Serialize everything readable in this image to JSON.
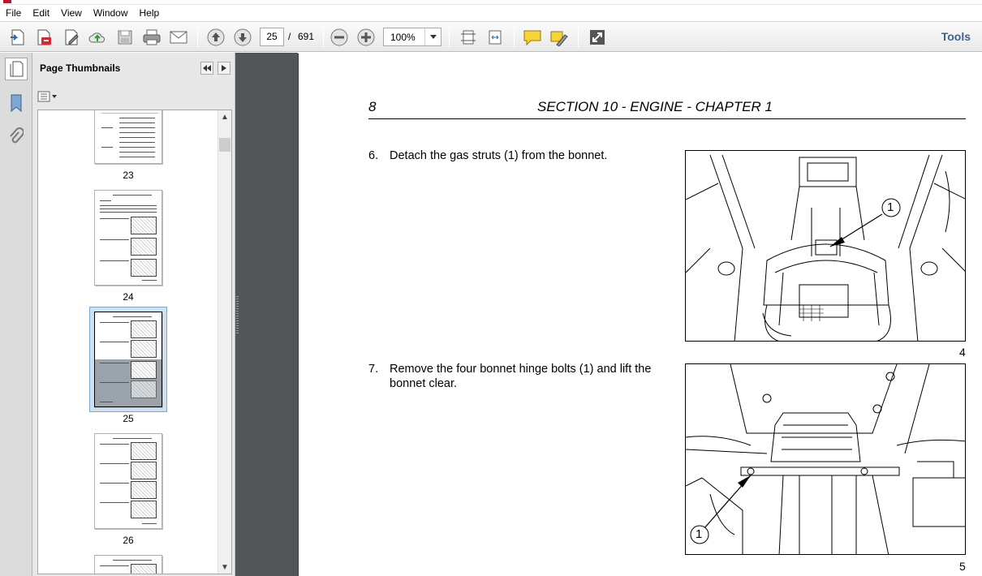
{
  "menu": [
    "File",
    "Edit",
    "View",
    "Window",
    "Help"
  ],
  "toolbar": {
    "current_page": "25",
    "page_separator": "/",
    "total_pages": "691",
    "zoom": "100%",
    "tools_label": "Tools"
  },
  "icons": {
    "create": "create-pdf-icon",
    "export": "export-pdf-icon",
    "edit": "edit-pdf-icon",
    "upload": "cloud-upload-icon",
    "save": "save-icon",
    "print": "print-icon",
    "email": "email-icon",
    "prev": "page-up-icon",
    "next": "page-down-icon",
    "zoom_out": "zoom-out-icon",
    "zoom_in": "zoom-in-icon",
    "fit_page": "fit-page-icon",
    "fit_width": "fit-width-icon",
    "comment": "sticky-note-icon",
    "highlight": "highlight-text-icon",
    "fullscreen": "full-screen-icon"
  },
  "sidebar": {
    "title": "Page Thumbnails",
    "thumbnails": [
      {
        "label": "23"
      },
      {
        "label": "24"
      },
      {
        "label": "25",
        "selected": true
      },
      {
        "label": "26"
      }
    ]
  },
  "document": {
    "page_number": "8",
    "section_title": "SECTION 10 - ENGINE - CHAPTER 1",
    "steps": [
      {
        "number": "6.",
        "text": "Detach the gas struts (1) from the bonnet.",
        "figure_number": "4",
        "callout": "1"
      },
      {
        "number": "7.",
        "text": "Remove the four bonnet hinge bolts (1) and lift the bonnet clear.",
        "figure_number": "5",
        "callout": "1"
      }
    ]
  },
  "colors": {
    "accent": "#3f6296",
    "viewer_bg": "#525659",
    "selection": "#cce1f4"
  }
}
